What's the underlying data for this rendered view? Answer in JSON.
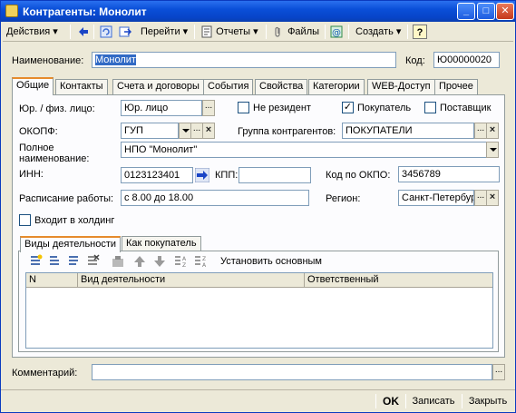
{
  "window": {
    "title": "Контрагенты: Монолит"
  },
  "toolbar": {
    "actions": "Действия",
    "goto": "Перейти",
    "reports": "Отчеты",
    "files": "Файлы",
    "create": "Создать",
    "help": "?"
  },
  "header": {
    "name_label": "Наименование:",
    "name_value": "Монолит",
    "code_label": "Код:",
    "code_value": "Ю00000020"
  },
  "tabs": [
    "Общие",
    "Контакты",
    "Счета и договоры",
    "События",
    "Свойства",
    "Категории",
    "WEB-Доступ",
    "Прочее"
  ],
  "general": {
    "legal_label": "Юр. / физ. лицо:",
    "legal_value": "Юр. лицо",
    "nonresident_label": "Не резидент",
    "buyer_label": "Покупатель",
    "supplier_label": "Поставщик",
    "okopf_label": "ОКОПФ:",
    "okopf_value": "ГУП",
    "group_label": "Группа контрагентов:",
    "group_value": "ПОКУПАТЕЛИ",
    "fullname_label": "Полное наименование:",
    "fullname_value": "НПО \"Монолит\"",
    "inn_label": "ИНН:",
    "inn_value": "0123123401",
    "kpp_label": "КПП:",
    "kpp_value": "",
    "okpo_label": "Код по ОКПО:",
    "okpo_value": "3456789",
    "schedule_label": "Расписание работы:",
    "schedule_value": "с 8.00 до 18.00",
    "region_label": "Регион:",
    "region_value": "Санкт-Петербург",
    "holding_label": "Входит в холдинг",
    "nonresident_checked": false,
    "buyer_checked": true,
    "supplier_checked": false,
    "holding_checked": false
  },
  "subtabs": [
    "Виды деятельности",
    "Как покупатель"
  ],
  "subtoolbar": {
    "set_main": "Установить основным"
  },
  "grid": {
    "columns": [
      "N",
      "Вид деятельности",
      "Ответственный"
    ]
  },
  "footer": {
    "comment_label": "Комментарий:",
    "comment_value": "",
    "ok": "OK",
    "save": "Записать",
    "close": "Закрыть"
  }
}
